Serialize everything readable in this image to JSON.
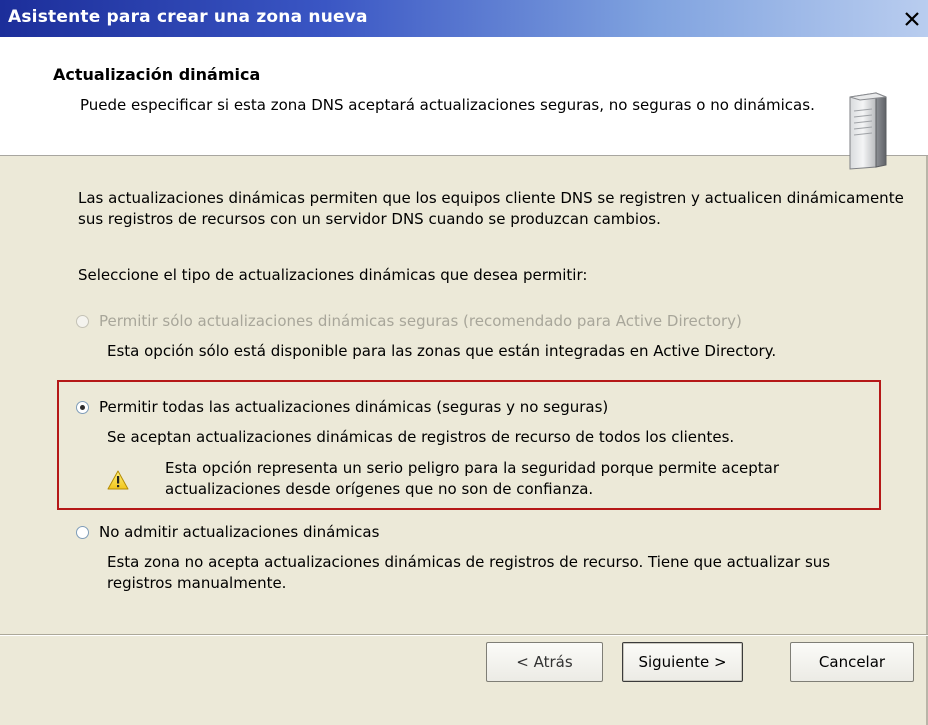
{
  "window": {
    "title": "Asistente para crear una zona nueva",
    "close_label": "×"
  },
  "header": {
    "title": "Actualización dinámica",
    "description": "Puede especificar si esta zona DNS aceptará actualizaciones seguras, no seguras o no dinámicas."
  },
  "intro": "Las actualizaciones dinámicas permiten que los equipos cliente DNS se registren y actualicen dinámicamente sus registros de recursos con un servidor DNS cuando se produzcan cambios.",
  "prompt": "Seleccione el tipo de actualizaciones dinámicas que desea permitir:",
  "options": [
    {
      "label": "Permitir sólo actualizaciones dinámicas seguras (recomendado para Active Directory)",
      "description": "Esta opción sólo está disponible para las zonas que están integradas en Active Directory.",
      "checked": false,
      "disabled": true
    },
    {
      "label": "Permitir todas las actualizaciones dinámicas (seguras y no seguras)",
      "description": "Se aceptan actualizaciones dinámicas de registros de recurso de todos los clientes.",
      "warning": "Esta opción representa un serio peligro para la seguridad porque permite aceptar actualizaciones desde orígenes que no son de confianza.",
      "checked": true,
      "disabled": false
    },
    {
      "label": "No admitir actualizaciones dinámicas",
      "description": "Esta zona no acepta actualizaciones dinámicas de registros de recurso. Tiene que actualizar sus registros manualmente.",
      "checked": false,
      "disabled": false
    }
  ],
  "buttons": {
    "back": "< Atrás",
    "next": "Siguiente >",
    "cancel": "Cancelar"
  },
  "icons": {
    "close": "close-icon",
    "server": "server-icon",
    "warning": "warning-icon"
  },
  "colors": {
    "title_bar_start": "#1c2e9a",
    "title_bar_end": "#b9cdef",
    "dialog_background": "#ece9d8",
    "highlight_border": "#b51818",
    "disabled_text": "#a8a69a"
  }
}
